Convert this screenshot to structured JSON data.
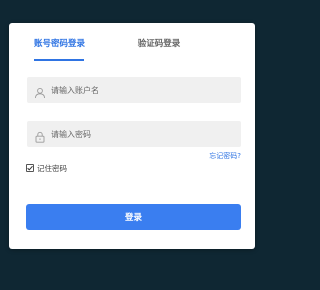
{
  "tabs": [
    {
      "label": "账号密码登录",
      "active": true
    },
    {
      "label": "验证码登录",
      "active": false
    }
  ],
  "username": {
    "placeholder": "请输入账户名",
    "value": "",
    "icon": "user-icon"
  },
  "password": {
    "placeholder": "请输入密码",
    "value": "",
    "icon": "lock-icon"
  },
  "forgot_password": "忘记密码?",
  "remember": {
    "label": "记住密码",
    "checked": true
  },
  "login_button": "登录",
  "colors": {
    "accent": "#2f74e3",
    "button": "#3a7ef0",
    "background": "#0f2733",
    "field": "#f0f0f0"
  }
}
